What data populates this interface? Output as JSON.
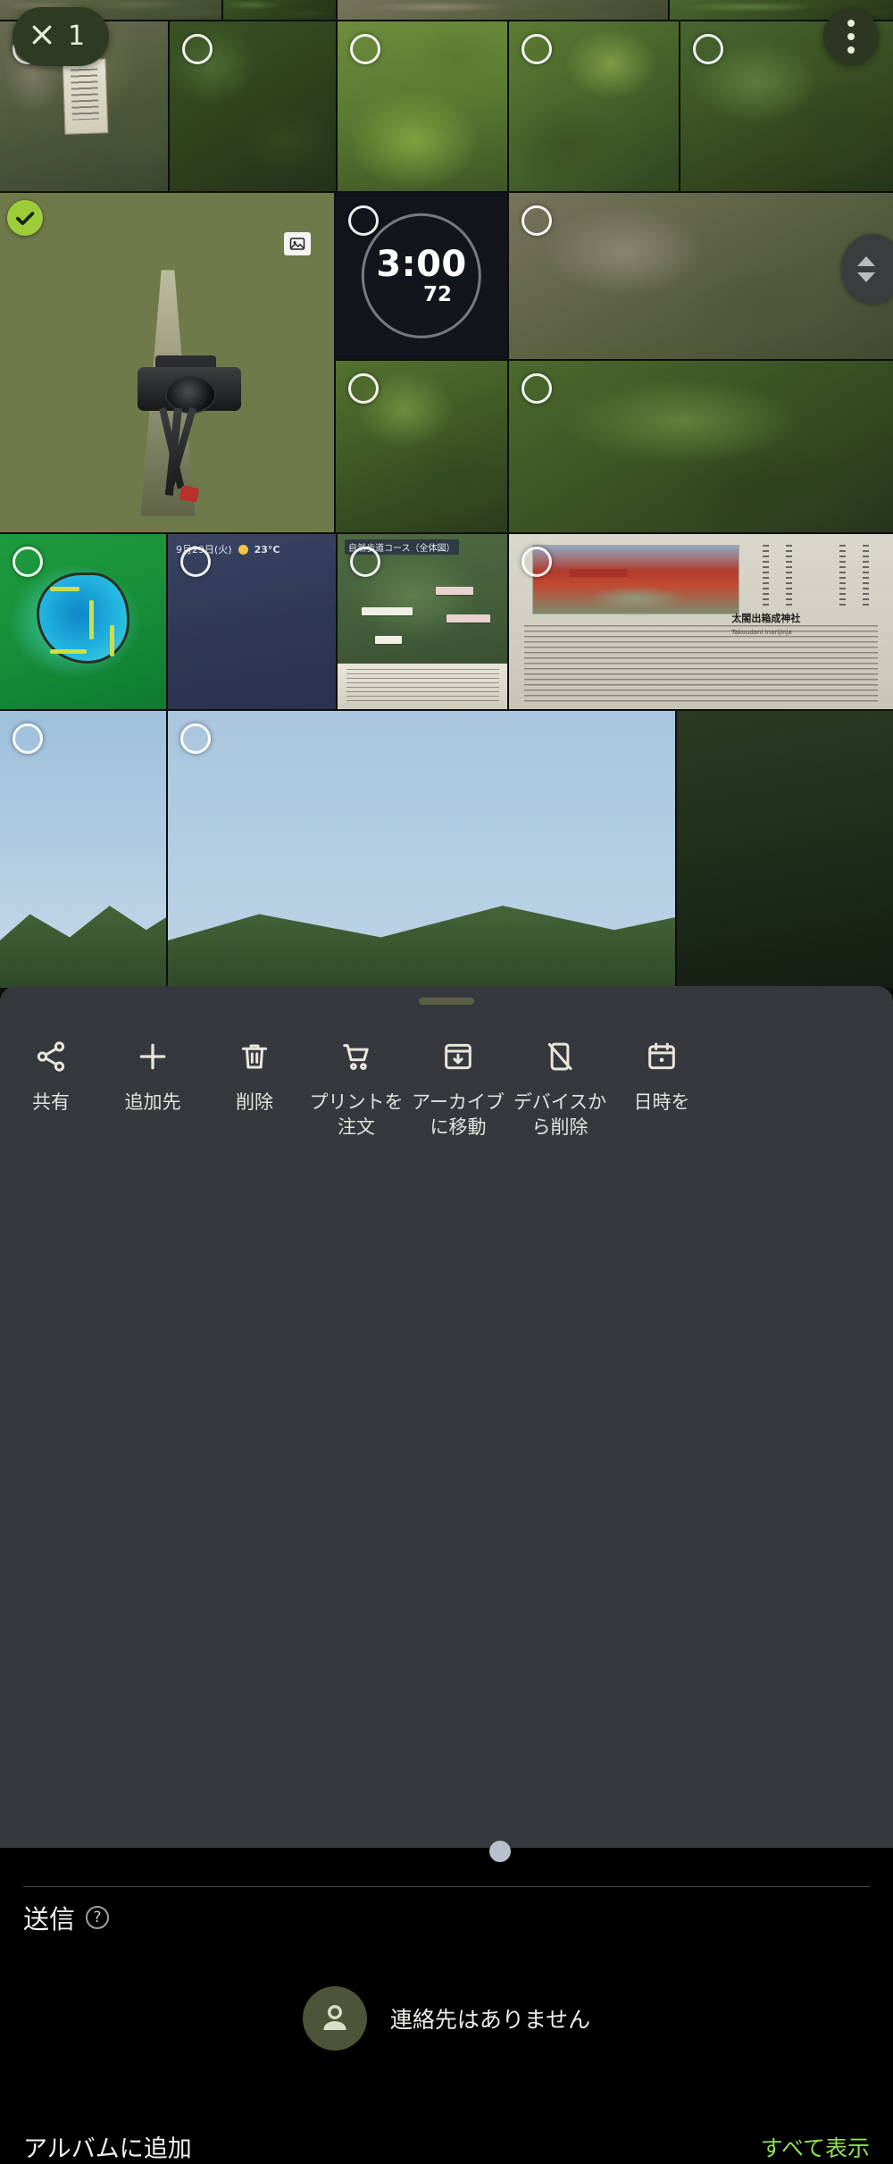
{
  "app": {
    "name": "Google Photos",
    "screen": "photo-grid-selection-share-sheet"
  },
  "selection_bar": {
    "close_icon": "close-icon",
    "selected_count": "1",
    "overflow_icon": "more-vert-icon",
    "chip_bg": "#2e3a22"
  },
  "scrollbar": {
    "thumb_icon": "up-down-arrows-icon"
  },
  "grid": {
    "selected_badge_icon": "check-circle-icon",
    "selected_badge_color": "#9ccc3a",
    "unselected_badge_icon": "circle-outline-icon",
    "selected_tile_caption_icon": "photo-badge-icon",
    "tiles": [
      {
        "id": "t1",
        "kind": "nature-rock",
        "selected": false
      },
      {
        "id": "t2",
        "kind": "nature-moss",
        "selected": false
      },
      {
        "id": "t3",
        "kind": "trail-sign",
        "selected": false
      },
      {
        "id": "t4",
        "kind": "forest-path",
        "selected": false
      },
      {
        "id": "t5",
        "kind": "mossy-field",
        "selected": false
      },
      {
        "id": "t6",
        "kind": "green-forest",
        "selected": false
      },
      {
        "id": "t7",
        "kind": "camera-tripod",
        "selected": true
      },
      {
        "id": "t8",
        "kind": "timer-screenshot",
        "selected": false
      },
      {
        "id": "t9",
        "kind": "stone-stream",
        "selected": false
      },
      {
        "id": "t10",
        "kind": "tall-trees",
        "selected": false
      },
      {
        "id": "t11",
        "kind": "forest-stream",
        "selected": false
      },
      {
        "id": "t12",
        "kind": "contour-map",
        "selected": false
      },
      {
        "id": "t13",
        "kind": "weather-screenshot",
        "selected": false
      },
      {
        "id": "t14",
        "kind": "trail-board",
        "selected": false
      },
      {
        "id": "t15",
        "kind": "shrine-board",
        "selected": false
      },
      {
        "id": "t16",
        "kind": "sky",
        "selected": false
      },
      {
        "id": "t17",
        "kind": "sky-wide",
        "selected": false
      },
      {
        "id": "t18",
        "kind": "dark-vegetation",
        "selected": false
      }
    ],
    "timer_tile": {
      "time": "3:00",
      "sub": "72"
    },
    "weather_tile": {
      "date": "9月29日(火)",
      "temp": "23°C",
      "sun_icon": "sun-icon"
    },
    "board_tile": {
      "caption": "自然歩道コース（全体図）"
    },
    "shrine_tile": {
      "title": "太閤出箱成神社",
      "subtitle": "Takoudani Inarijinja",
      "right_title": "深寺"
    }
  },
  "sheet": {
    "handle": "drag-handle",
    "actions": [
      {
        "label": "共有",
        "icon": "share-icon"
      },
      {
        "label": "追加先",
        "icon": "plus-icon"
      },
      {
        "label": "削除",
        "icon": "trash-icon"
      },
      {
        "label": "プリントを注文",
        "icon": "cart-icon"
      },
      {
        "label": "アーカイブに移動",
        "icon": "archive-icon"
      },
      {
        "label": "デバイスから削除",
        "icon": "phone-off-icon"
      },
      {
        "label": "日時を",
        "icon": "calendar-icon"
      }
    ],
    "send": {
      "label": "送信",
      "help_icon": "help-circle-icon"
    },
    "contacts": {
      "empty_label": "連絡先はありません",
      "avatar_icon": "person-icon",
      "avatar_bg": "#4d5438"
    },
    "album": {
      "label": "アルバムに追加",
      "see_all": "すべて表示",
      "see_all_color": "#8ce053"
    },
    "background": "#35383c"
  }
}
